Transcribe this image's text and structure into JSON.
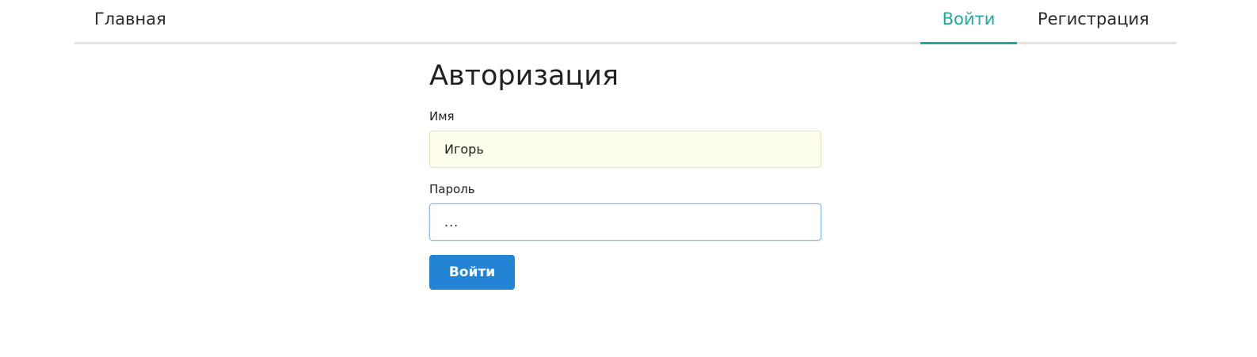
{
  "nav": {
    "home": "Главная",
    "login": "Войти",
    "register": "Регистрация"
  },
  "form": {
    "title": "Авторизация",
    "name_label": "Имя",
    "name_value": "Игорь",
    "password_label": "Пароль",
    "password_value": "...",
    "submit_label": "Войти"
  },
  "colors": {
    "active_nav": "#1fa99c",
    "button": "#2284d3",
    "autofill_bg": "#fefeec",
    "focus_border": "#8ab9dd"
  }
}
